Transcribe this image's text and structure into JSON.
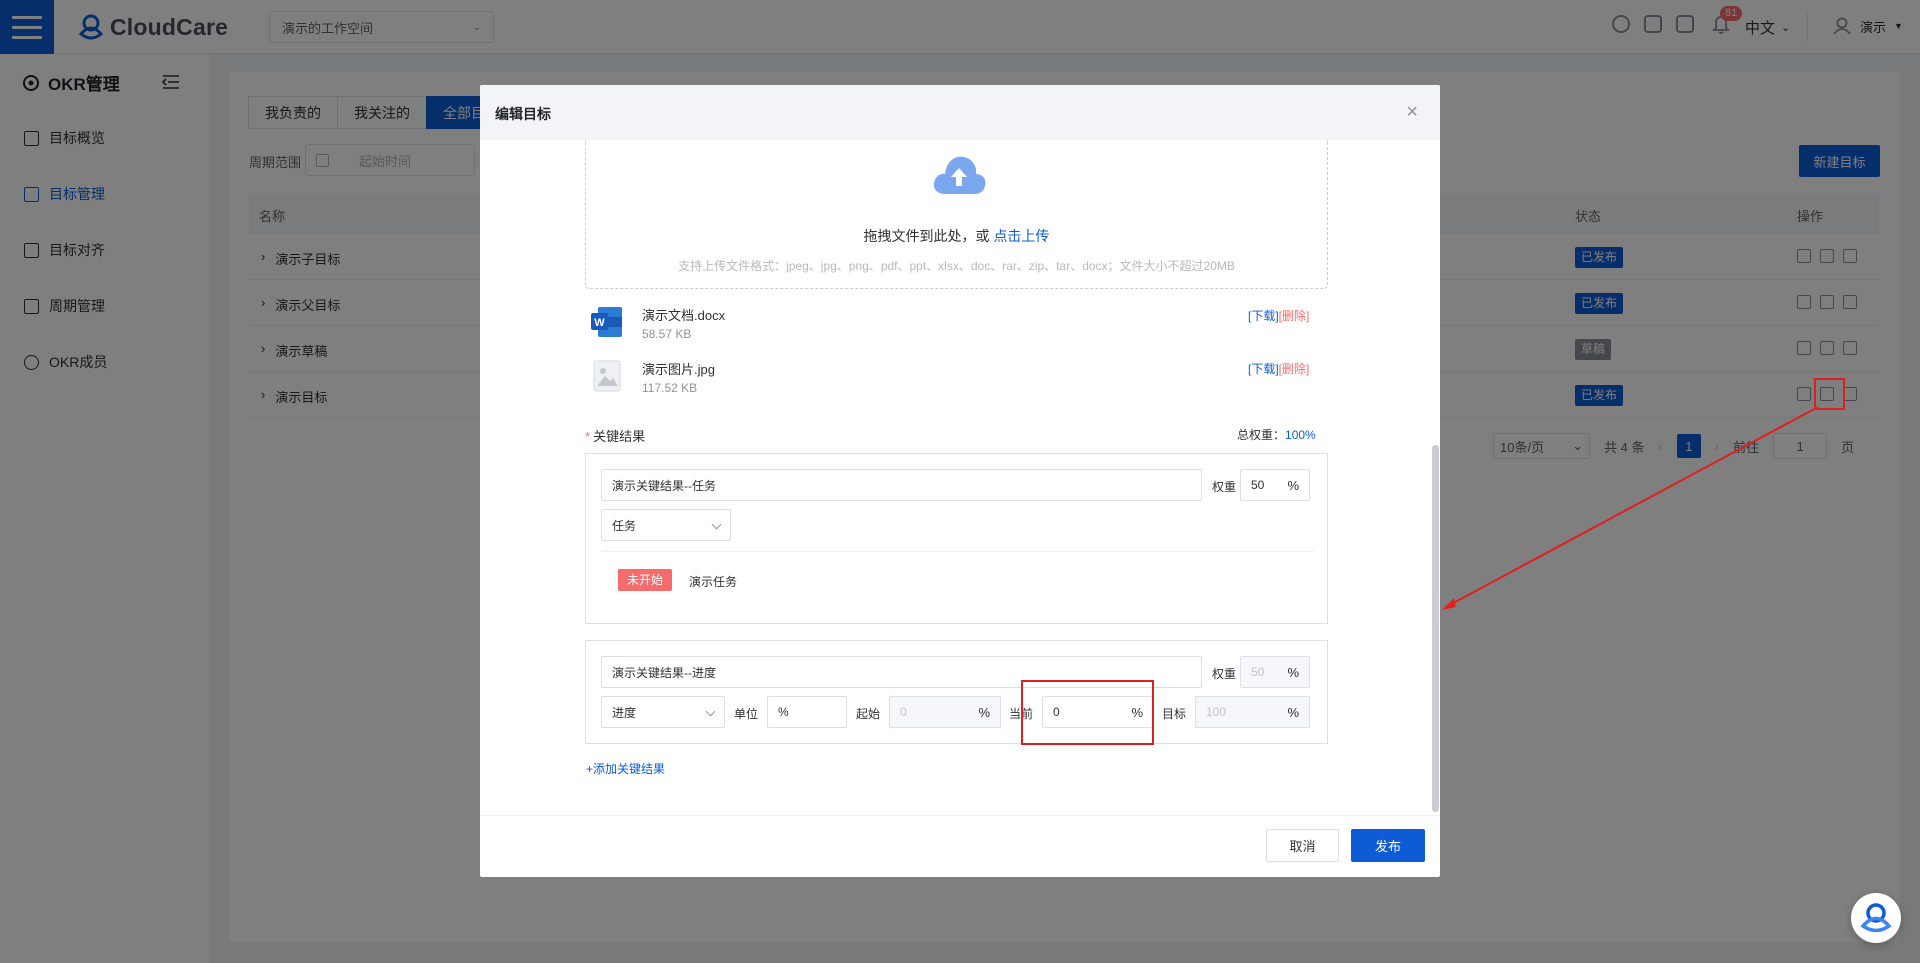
{
  "header": {
    "logo_text": "CloudCare",
    "workspace": "演示的工作空间",
    "notification_count": "81",
    "language": "中文",
    "user": "演示"
  },
  "sidebar": {
    "title": "OKR管理",
    "items": [
      {
        "label": "目标概览",
        "icon": "dashboard-icon"
      },
      {
        "label": "目标管理",
        "icon": "list-icon",
        "active": true
      },
      {
        "label": "目标对齐",
        "icon": "align-icon"
      },
      {
        "label": "周期管理",
        "icon": "calendar-icon"
      },
      {
        "label": "OKR成员",
        "icon": "user-icon"
      }
    ]
  },
  "main": {
    "tabs": [
      "我负责的",
      "我关注的",
      "全部目"
    ],
    "filter_label": "周期范围",
    "date_placeholder": "起始时间",
    "new_button": "新建目标",
    "columns": {
      "name": "名称",
      "status": "状态",
      "ops": "操作"
    },
    "rows": [
      {
        "name": "演示子目标",
        "status": "已发布",
        "draft": false
      },
      {
        "name": "演示父目标",
        "status": "已发布",
        "draft": false
      },
      {
        "name": "演示草稿",
        "status": "草稿",
        "draft": true
      },
      {
        "name": "演示目标",
        "status": "已发布",
        "draft": false
      }
    ],
    "pager": {
      "size": "10条/页",
      "total": "共 4 条",
      "page": "1",
      "goto": "前往",
      "goto_value": "1",
      "page_unit": "页"
    }
  },
  "dialog": {
    "title": "编辑目标",
    "upload_text": "拖拽文件到此处，或 ",
    "upload_link": "点击上传",
    "upload_hint": "支持上传文件格式：jpeg、jpg、png、pdf、ppt、xlsx、doc、rar、zip、tar、docx；文件大小不超过20MB",
    "files": [
      {
        "name": "演示文档.docx",
        "size": "58.57 KB",
        "icon": "word-file-icon"
      },
      {
        "name": "演示图片.jpg",
        "size": "117.52 KB",
        "icon": "image-file-icon"
      }
    ],
    "download_label": "[下载]",
    "delete_label": "[删除]",
    "kr_label": "关键结果",
    "total_weight_label": "总权重：",
    "total_weight_value": "100%",
    "kr1": {
      "name": "演示关键结果--任务",
      "weight_label": "权重",
      "weight": "50",
      "pct": "%",
      "type": "任务",
      "task_status": "未开始",
      "task_name": "演示任务"
    },
    "kr2": {
      "name": "演示关键结果--进度",
      "weight_label": "权重",
      "weight": "50",
      "pct": "%",
      "type": "进度",
      "unit_label": "单位",
      "unit": "%",
      "start_label": "起始",
      "start": "0",
      "current_label": "当前",
      "current": "0",
      "target_label": "目标",
      "target": "100"
    },
    "add_kr": "+添加关键结果",
    "cancel": "取消",
    "publish": "发布"
  },
  "colors": {
    "primary": "#0d5cd6",
    "danger": "#f56c6c",
    "annotation": "#e02020"
  }
}
